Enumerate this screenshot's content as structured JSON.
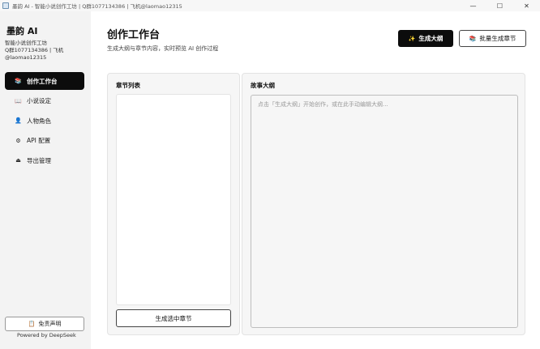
{
  "window": {
    "title": "墨韵 AI - 智能小说创作工坊 | Q群1077134386 | 飞机@laomao12315",
    "controls": [
      "—",
      "☐",
      "✕"
    ]
  },
  "sidebar": {
    "brand": "墨韵 AI",
    "subtitle_line1": "智能小说创作工坊",
    "subtitle_line2": "Q群1077134386 | 飞机",
    "subtitle_line3": "@laomao12315",
    "items": [
      {
        "label": "创作工作台",
        "icon": "books-icon",
        "glyph": "📚",
        "active": true
      },
      {
        "label": "小说设定",
        "icon": "book-icon",
        "glyph": "📖",
        "active": false
      },
      {
        "label": "人物角色",
        "icon": "person-icon",
        "glyph": "👤",
        "active": false
      },
      {
        "label": "API 配置",
        "icon": "gear-icon",
        "glyph": "⚙",
        "active": false
      },
      {
        "label": "导出管理",
        "icon": "export-icon",
        "glyph": "⏏",
        "active": false
      }
    ],
    "disclaimer": {
      "label": "免责声明",
      "icon": "document-icon",
      "glyph": "📋"
    },
    "powered_by": "Powered by DeepSeek"
  },
  "main": {
    "title": "创作工作台",
    "subtitle": "生成大纲与章节内容，实时预览 AI 创作过程",
    "generate_outline": {
      "label": "生成大纲",
      "icon": "sparkles-icon",
      "glyph": "✨"
    },
    "batch_generate": {
      "label": "批量生成章节",
      "icon": "stack-icon",
      "glyph": "📚"
    },
    "chapters": {
      "title": "章节列表",
      "items": [],
      "button_label": "生成选中章节"
    },
    "outline": {
      "title": "故事大纲",
      "value": "",
      "placeholder": "点击「生成大纲」开始创作，或在此手动编辑大纲..."
    }
  },
  "colors": {
    "accent": "#0c0c0c",
    "background": "#f3f3f3",
    "panel": "#f6f6f6"
  }
}
